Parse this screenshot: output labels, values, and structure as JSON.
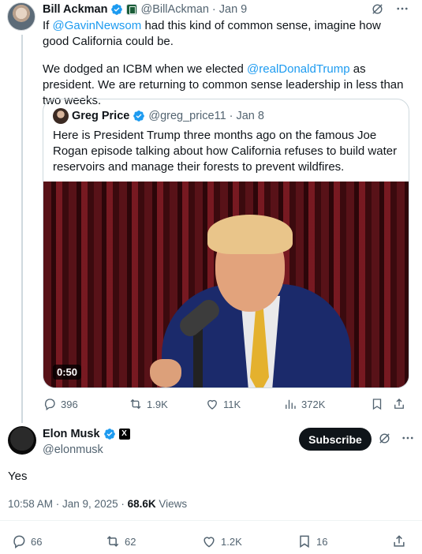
{
  "parent_tweet": {
    "name": "Bill Ackman",
    "handle": "@BillAckman",
    "date": "· Jan 9",
    "text1_prefix": "If ",
    "text1_mention": "@GavinNewsom",
    "text1_suffix": " had this kind of common sense, imagine how good California could be.",
    "text2_prefix": "We dodged an ICBM when we elected ",
    "text2_mention": "@realDonaldTrump",
    "text2_suffix": " as president. We are returning to common sense leadership in less than two weeks.",
    "actions": {
      "replies": "396",
      "reposts": "1.9K",
      "likes": "11K",
      "views": "372K"
    }
  },
  "quoted_tweet": {
    "name": "Greg Price",
    "handle": "@greg_price11",
    "date": "· Jan 8",
    "text": "Here is President Trump three months ago on the famous Joe Rogan episode talking about how California refuses to build water reservoirs and manage their forests to prevent wildfires.",
    "video_duration": "0:50"
  },
  "main_tweet": {
    "name": "Elon Musk",
    "handle": "@elonmusk",
    "subscribe_label": "Subscribe",
    "text": "Yes",
    "time": "10:58 AM · Jan 9, 2025 · ",
    "views_count": "68.6K",
    "views_label": " Views",
    "actions": {
      "replies": "66",
      "reposts": "62",
      "likes": "1.2K",
      "bookmarks": "16"
    }
  },
  "colors": {
    "accent": "#1d9bf0",
    "text": "#0f1419",
    "muted": "#536471",
    "border": "#cfd9de"
  }
}
